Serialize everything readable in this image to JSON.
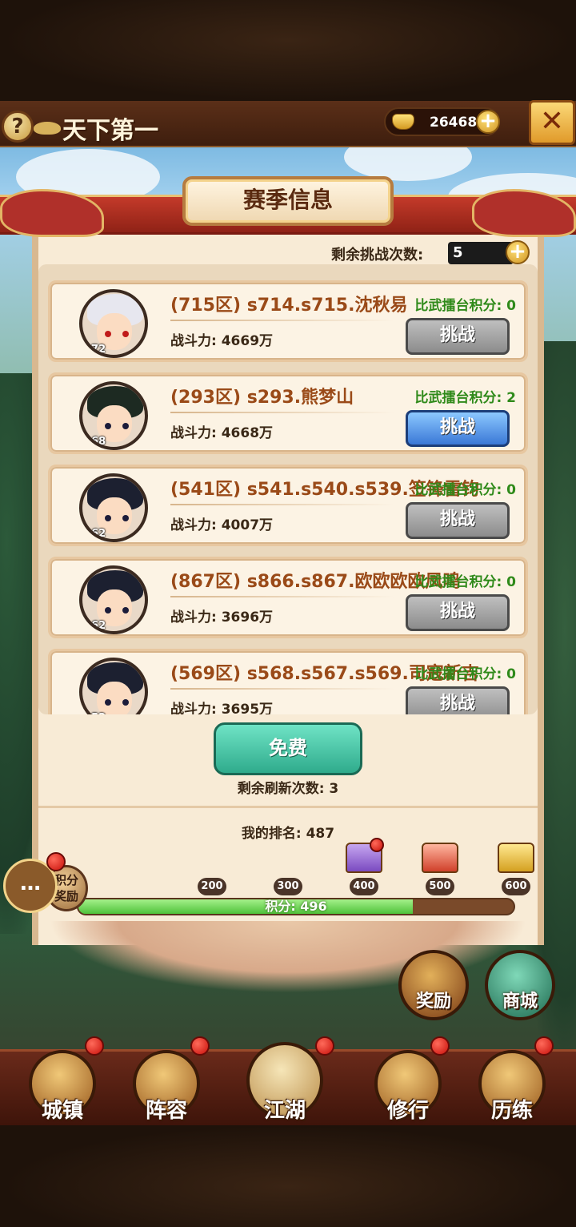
{
  "header": {
    "title": "天下第一",
    "help_icon": "?",
    "gold": "26468",
    "close_icon": "crossed-swords-icon"
  },
  "season_tab": "赛季信息",
  "remaining_challenges": {
    "label": "剩余挑战次数:",
    "value": "5"
  },
  "players": [
    {
      "name": "(715区) s714.s715.沈秋易",
      "score": "比武擂台积分: 0",
      "power": "战斗力: 4669万",
      "level": "172",
      "button": "挑战"
    },
    {
      "name": "(293区) s293.熊梦山",
      "score": "比武擂台积分: 2",
      "power": "战斗力: 4668万",
      "level": "168",
      "button": "挑战"
    },
    {
      "name": "(541区) s541.s540.s539.签锋雷钧",
      "score": "比武擂台积分: 0",
      "power": "战斗力: 4007万",
      "level": "162",
      "button": "挑战"
    },
    {
      "name": "(867区) s866.s867.欧欧欧欧凤鸣",
      "score": "比武擂台积分: 0",
      "power": "战斗力: 3696万",
      "level": "162",
      "button": "挑战"
    },
    {
      "name": "(569区) s568.s567.s569.司寇新吉",
      "score": "比武擂台积分: 0",
      "power": "战斗力: 3695万",
      "level": "152",
      "button": "挑战"
    }
  ],
  "free_button": "免费",
  "refresh": "剩余刷新次数: 3",
  "my_rank": "我的排名: 487",
  "milestones": [
    "200",
    "300",
    "400",
    "500",
    "600"
  ],
  "progress": {
    "label": "积分: 496",
    "value": 496,
    "max": 600,
    "min": 150
  },
  "score_reward": "积分\n奖励",
  "chat_icon": "…",
  "side_buttons": {
    "reward": "奖励",
    "shop": "商城"
  },
  "nav": [
    "城镇",
    "阵容",
    "江湖",
    "修行",
    "历练"
  ],
  "colors": {
    "accent_red": "#c43a2a",
    "score_green": "#2f8a1a",
    "name_brown": "#9a4a18",
    "button_blue": "#3a78d6"
  }
}
